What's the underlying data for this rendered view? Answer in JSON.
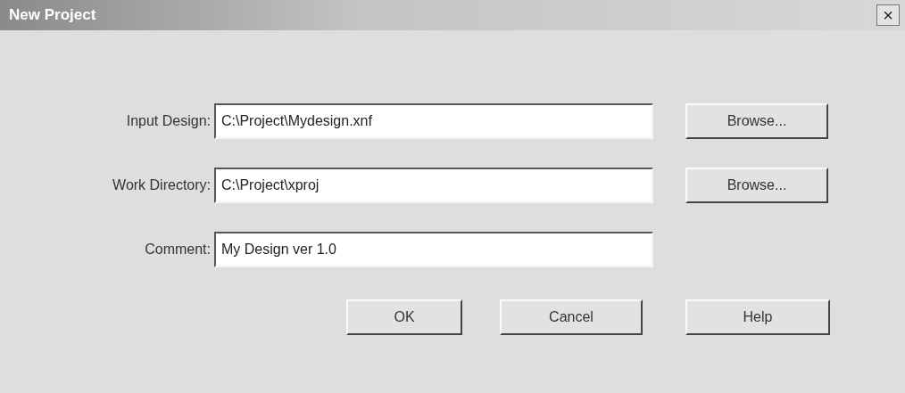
{
  "window": {
    "title": "New Project",
    "close": "×"
  },
  "fields": [
    {
      "label": "Input Design:",
      "value": "C:\\Project\\Mydesign.xnf",
      "button": "Browse..."
    },
    {
      "label": "Work Directory:",
      "value": "C:\\Project\\xproj",
      "button": "Browse..."
    },
    {
      "label": "Comment:",
      "value": "My Design ver 1.0"
    }
  ],
  "buttons": [
    "OK",
    "Cancel",
    "Help"
  ]
}
